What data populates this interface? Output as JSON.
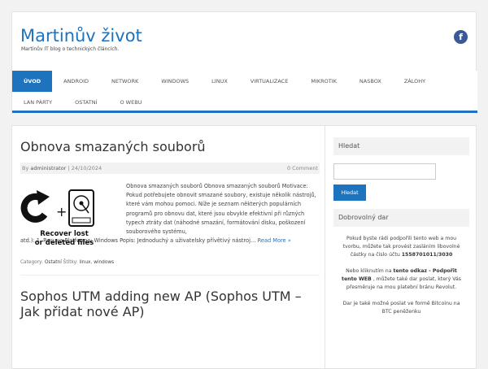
{
  "site": {
    "title": "Martinův život",
    "description": "Martinův IT blog o technických článcích.",
    "facebook_icon": "f"
  },
  "nav": {
    "row1": [
      "ÚVOD",
      "ANDROID",
      "NETWORK",
      "WINDOWS",
      "LINUX",
      "VIRTUALIZACE",
      "MIKROTIK",
      "NASBOX",
      "ZÁLOHY"
    ],
    "row2": [
      "LAN PÁRTY",
      "OSTATNÍ",
      "O WEBU"
    ]
  },
  "post1": {
    "title": "Obnova smazaných souborů",
    "author_prefix": "By",
    "author": "administrator",
    "separator": "|",
    "date": "24/10/2024",
    "comments": "0 Comment",
    "image_caption_1": "Recover lost",
    "image_caption_2": "or deleted files",
    "excerpt_wrapped": "Obnova smazaných souborů Obnova smazaných souborů Motivace: Pokud potřebujete obnovit smazané soubory, existuje několik nástrojů, které vám mohou pomoci. Níže je seznam některých populárních programů pro obnovu dat, které jsou obvykle efektivní při různých typech ztráty dat (náhodné smazání, formátování disku, poškození souborového systému,",
    "excerpt_full": "atd.): 1. Recuva Platforma: Windows Popis: Jednoduchý a uživatelsky přívětivý nástroj…",
    "read_more": "Read More »",
    "category_label": "Category:",
    "category": "Ostatní",
    "tags_label": "Štítky:",
    "tag1": "linux",
    "tag_sep": ",",
    "tag2": "windows"
  },
  "post2": {
    "title": "Sophos UTM adding new AP (Sophos UTM – Jak přidat nové AP)"
  },
  "sidebar": {
    "search_title": "Hledat",
    "search_button": "Hledat",
    "donate_title": "Dobrovolný dar",
    "donate_p1": "Pokud byste rádi podpořili tento web a mou tvorbu, můžete tak provést zasláním libovolné částky na číslo účtu",
    "account": "1558701011/3030",
    "donate_p2_a": "Nebo kliknutím na",
    "donate_p2_link": "tento odkaz - Podpořit tento WEB",
    "donate_p2_b": ", můžete také dar poslat, který Vás přesměruje na mou platební bránu Revolut.",
    "donate_p3": "Dar je také možné poslat ve formě Bitcoinu na BTC peněženku"
  },
  "colors": {
    "accent": "#1e73be",
    "facebook": "#3b5998"
  }
}
